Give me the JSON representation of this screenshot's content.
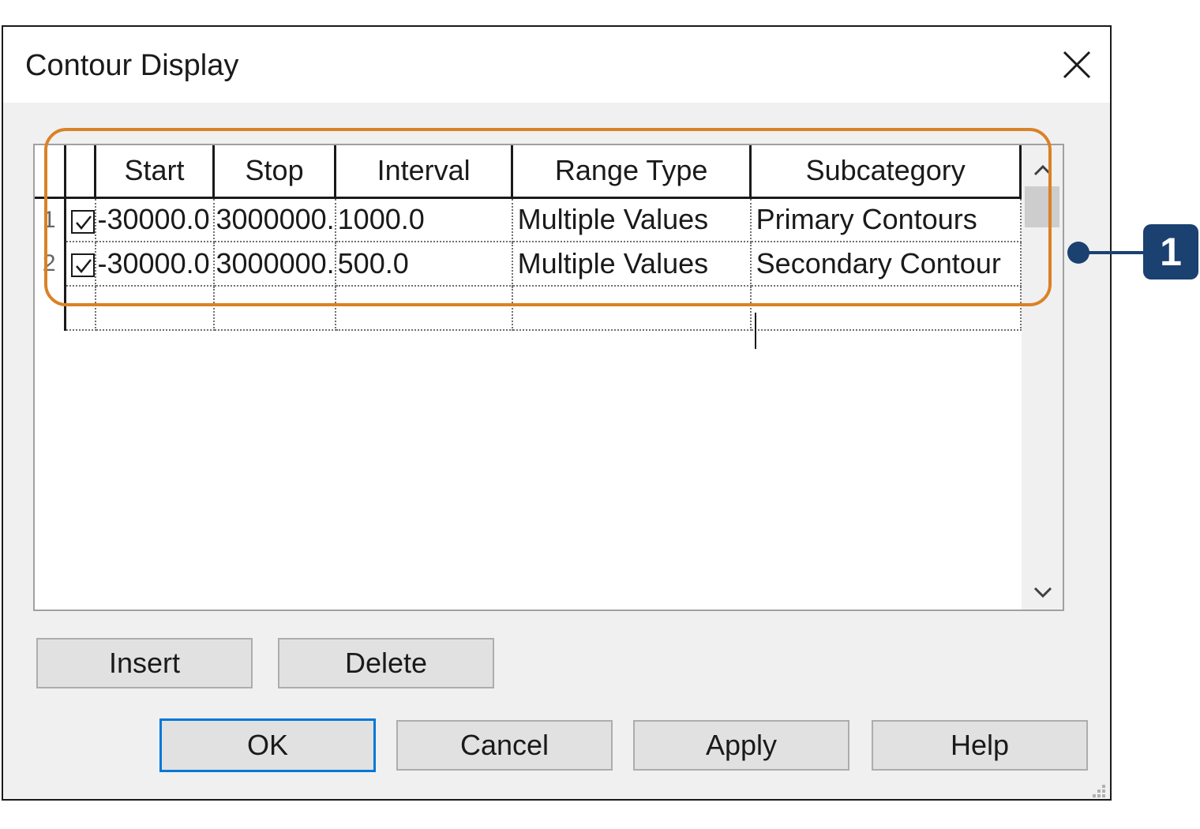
{
  "dialog": {
    "title": "Contour Display"
  },
  "grid": {
    "headers": [
      "Start",
      "Stop",
      "Interval",
      "Range Type",
      "Subcategory"
    ],
    "rows": [
      {
        "num": "1",
        "checked": true,
        "start": "-30000.0",
        "stop": "3000000.",
        "interval": "1000.0",
        "range_type": "Multiple Values",
        "subcategory": "Primary Contours"
      },
      {
        "num": "2",
        "checked": true,
        "start": "-30000.0",
        "stop": "3000000.",
        "interval": "500.0",
        "range_type": "Multiple Values",
        "subcategory": "Secondary Contour"
      }
    ]
  },
  "buttons": {
    "insert": "Insert",
    "delete": "Delete",
    "ok": "OK",
    "cancel": "Cancel",
    "apply": "Apply",
    "help": "Help"
  },
  "callout": {
    "label": "1"
  },
  "colors": {
    "highlight": "#d98226",
    "callout": "#1a4170",
    "default_button_border": "#0078d7"
  }
}
